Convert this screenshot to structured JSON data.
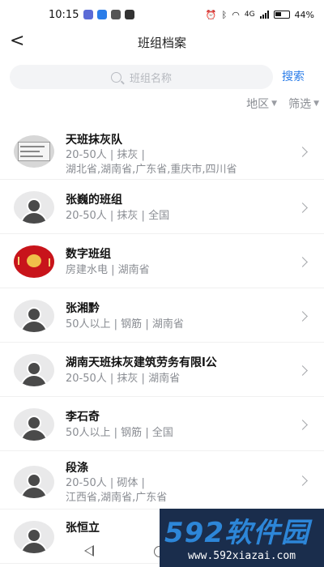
{
  "status_bar": {
    "time": "10:15",
    "battery": "44%",
    "network": "4G"
  },
  "header": {
    "title": "班组档案",
    "back_icon": "chevron-left-icon"
  },
  "search": {
    "placeholder": "班组名称",
    "button_label": "搜索"
  },
  "filters": {
    "region_label": "地区",
    "filter_label": "筛选"
  },
  "colors": {
    "accent": "#2b7de9",
    "meta_text": "#8a8d93"
  },
  "teams": [
    {
      "name": "天班抹灰队",
      "line1": "20-50人 | 抹灰 |",
      "line2": "湖北省,湖南省,广东省,重庆市,四川省",
      "avatar": "screenshot"
    },
    {
      "name": "张巍的班组",
      "line1": "20-50人 | 抹灰 | 全国",
      "avatar": "default"
    },
    {
      "name": "数字班组",
      "line1": "房建水电 | 湖南省",
      "avatar": "red"
    },
    {
      "name": "张湘黔",
      "line1": "50人以上 | 钢筋 | 湖南省",
      "avatar": "default"
    },
    {
      "name": "湖南天班抹灰建筑劳务有限l公",
      "line1": "20-50人 | 抹灰 | 湖南省",
      "avatar": "default"
    },
    {
      "name": "李石奇",
      "line1": "50人以上 | 钢筋 | 全国",
      "avatar": "default"
    },
    {
      "name": "段涤",
      "line1": "20-50人 | 砌体 |",
      "line2": "江西省,湖南省,广东省",
      "avatar": "default"
    },
    {
      "name": "张恒立",
      "avatar": "default"
    }
  ],
  "watermark": {
    "logo": "592软件园",
    "url": "www.592xiazai.com"
  }
}
